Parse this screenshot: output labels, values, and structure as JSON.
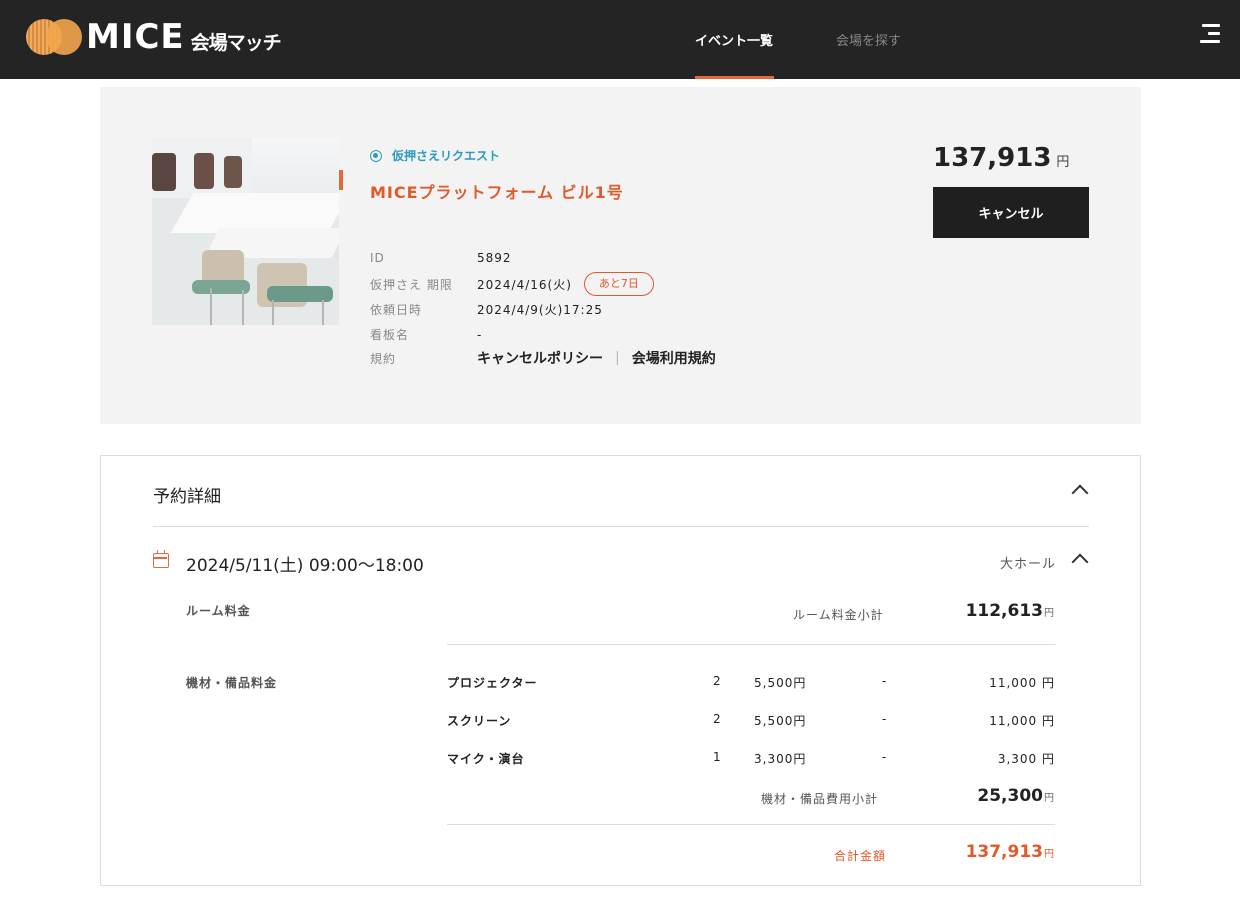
{
  "header": {
    "logo_text": "MICE",
    "logo_sub": "会場マッチ",
    "nav": [
      {
        "label": "イベント一覧"
      },
      {
        "label": "会場を探す"
      }
    ]
  },
  "summary": {
    "status": "仮押さえリクエスト",
    "venue_name": "MICEプラットフォーム ビル1号",
    "price": "137,913",
    "currency": "円",
    "cancel_label": "キャンセル",
    "info": {
      "id_label": "ID",
      "id_value": "5892",
      "hold_label": "仮押さえ 期限",
      "hold_value": "2024/4/16(火)",
      "hold_badge": "あと7日",
      "request_label": "依頼日時",
      "request_value": "2024/4/9(火)17:25",
      "sign_label": "看板名",
      "sign_value": "-",
      "terms_label": "規約",
      "cancel_policy": "キャンセルポリシー",
      "separator": "|",
      "venue_terms": "会場利用規約"
    }
  },
  "details": {
    "title": "予約詳細",
    "date": "2024/5/11(土)  09:00〜18:00",
    "hall": "大ホール",
    "room_fee_label": "ルーム料金",
    "room_subtotal_label": "ルーム料金小計",
    "room_subtotal": "112,613",
    "equipment_label": "機材・備品料金",
    "equipment_items": [
      {
        "name": "プロジェクター",
        "qty": "2",
        "price": "5,500円",
        "discount": "-",
        "total": "11,000 円"
      },
      {
        "name": "スクリーン",
        "qty": "2",
        "price": "5,500円",
        "discount": "-",
        "total": "11,000 円"
      },
      {
        "name": "マイク・演台",
        "qty": "1",
        "price": "3,300円",
        "discount": "-",
        "total": "3,300 円"
      }
    ],
    "equipment_subtotal_label": "機材・備品費用小計",
    "equipment_subtotal": "25,300",
    "total_label": "合計金額",
    "total": "137,913",
    "yen": "円"
  },
  "colors": {
    "accent": "#e05a2b",
    "status": "#2a9bc0",
    "header_bg": "#242424"
  }
}
